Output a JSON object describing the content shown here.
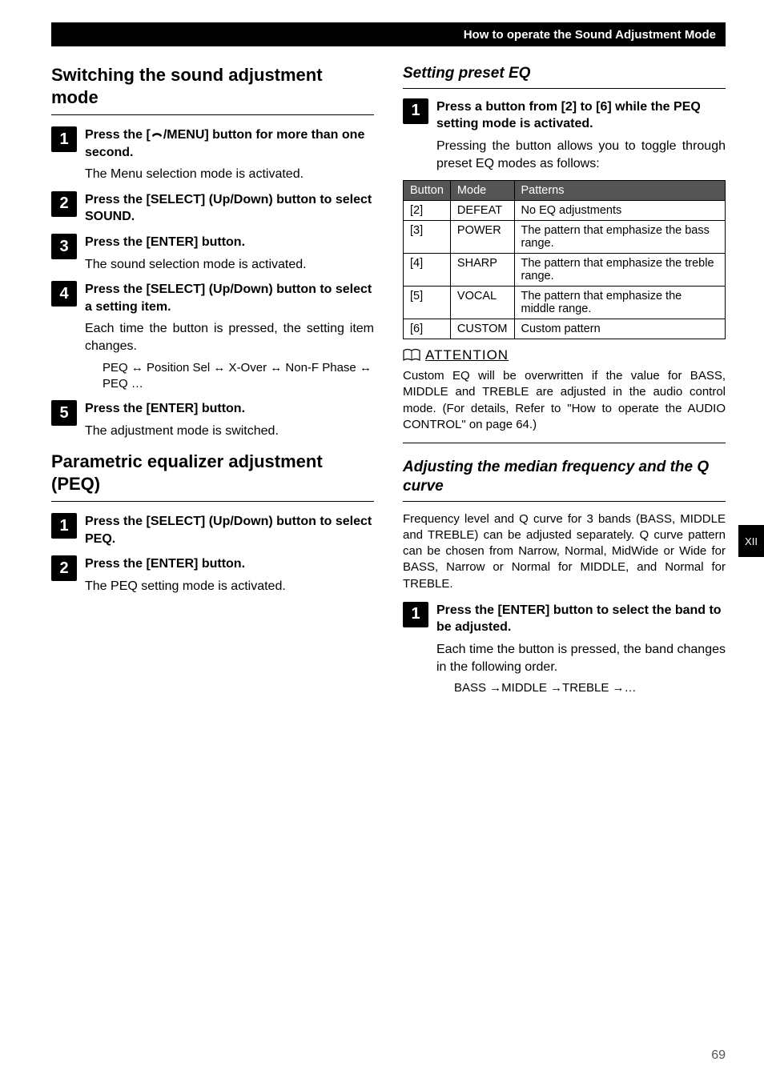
{
  "header": {
    "title": "How to operate the Sound Adjustment Mode"
  },
  "side_tab": "XII",
  "page_number": "69",
  "left": {
    "section1": {
      "title": "Switching the sound adjustment mode",
      "steps": {
        "s1": {
          "num": "1",
          "title_a": "Press the [",
          "title_b": "/MENU] button for more than one second.",
          "desc": "The Menu selection mode is activated."
        },
        "s2": {
          "num": "2",
          "title": "Press the [SELECT] (Up/Down) button to select SOUND."
        },
        "s3": {
          "num": "3",
          "title": "Press the [ENTER] button.",
          "desc": "The sound selection mode is activated."
        },
        "s4": {
          "num": "4",
          "title": "Press the [SELECT] (Up/Down) button to select a setting item.",
          "desc": "Each time the button is pressed, the setting item changes.",
          "sub": "PEQ ↔ Position Sel ↔ X-Over ↔ Non-F Phase ↔ PEQ …"
        },
        "s5": {
          "num": "5",
          "title": "Press the [ENTER] button.",
          "desc": "The adjustment mode is switched."
        }
      }
    },
    "section2": {
      "title": "Parametric equalizer adjustment (PEQ)",
      "steps": {
        "s1": {
          "num": "1",
          "title": "Press the [SELECT] (Up/Down) button to select PEQ."
        },
        "s2": {
          "num": "2",
          "title": "Press the [ENTER] button.",
          "desc": "The PEQ setting mode is activated."
        }
      }
    }
  },
  "right": {
    "sub1": {
      "title": "Setting preset EQ",
      "step1": {
        "num": "1",
        "title": "Press a button from [2] to [6] while the PEQ setting mode is activated.",
        "desc": "Pressing the button allows you to toggle through preset EQ modes as follows:"
      },
      "table": {
        "headers": [
          "Button",
          "Mode",
          "Patterns"
        ],
        "rows": [
          {
            "c0": "[2]",
            "c1": "DEFEAT",
            "c2": "No EQ adjustments"
          },
          {
            "c0": "[3]",
            "c1": "POWER",
            "c2": "The pattern that emphasize the bass range."
          },
          {
            "c0": "[4]",
            "c1": "SHARP",
            "c2": "The pattern that emphasize the treble range."
          },
          {
            "c0": "[5]",
            "c1": "VOCAL",
            "c2": "The pattern that emphasize the middle range."
          },
          {
            "c0": "[6]",
            "c1": "CUSTOM",
            "c2": "Custom pattern"
          }
        ]
      },
      "attention": {
        "title": "ATTENTION",
        "body": "Custom EQ will be overwritten if the value for BASS, MIDDLE and TREBLE are adjusted in the audio control mode. (For details, Refer to \"How to operate the AUDIO CONTROL\" on page 64.)"
      }
    },
    "sub2": {
      "title": "Adjusting the median frequency and the Q curve",
      "intro": "Frequency level and Q curve for 3 bands (BASS, MIDDLE and TREBLE) can be adjusted separately. Q curve pattern can be chosen from Narrow, Normal, MidWide or Wide for BASS, Narrow or Normal for MIDDLE, and Normal for TREBLE.",
      "step1": {
        "num": "1",
        "title": "Press the [ENTER] button to select the band to be adjusted.",
        "desc": "Each time the button is pressed, the band changes in the following order.",
        "sub": "BASS →MIDDLE →TREBLE →…"
      }
    }
  }
}
